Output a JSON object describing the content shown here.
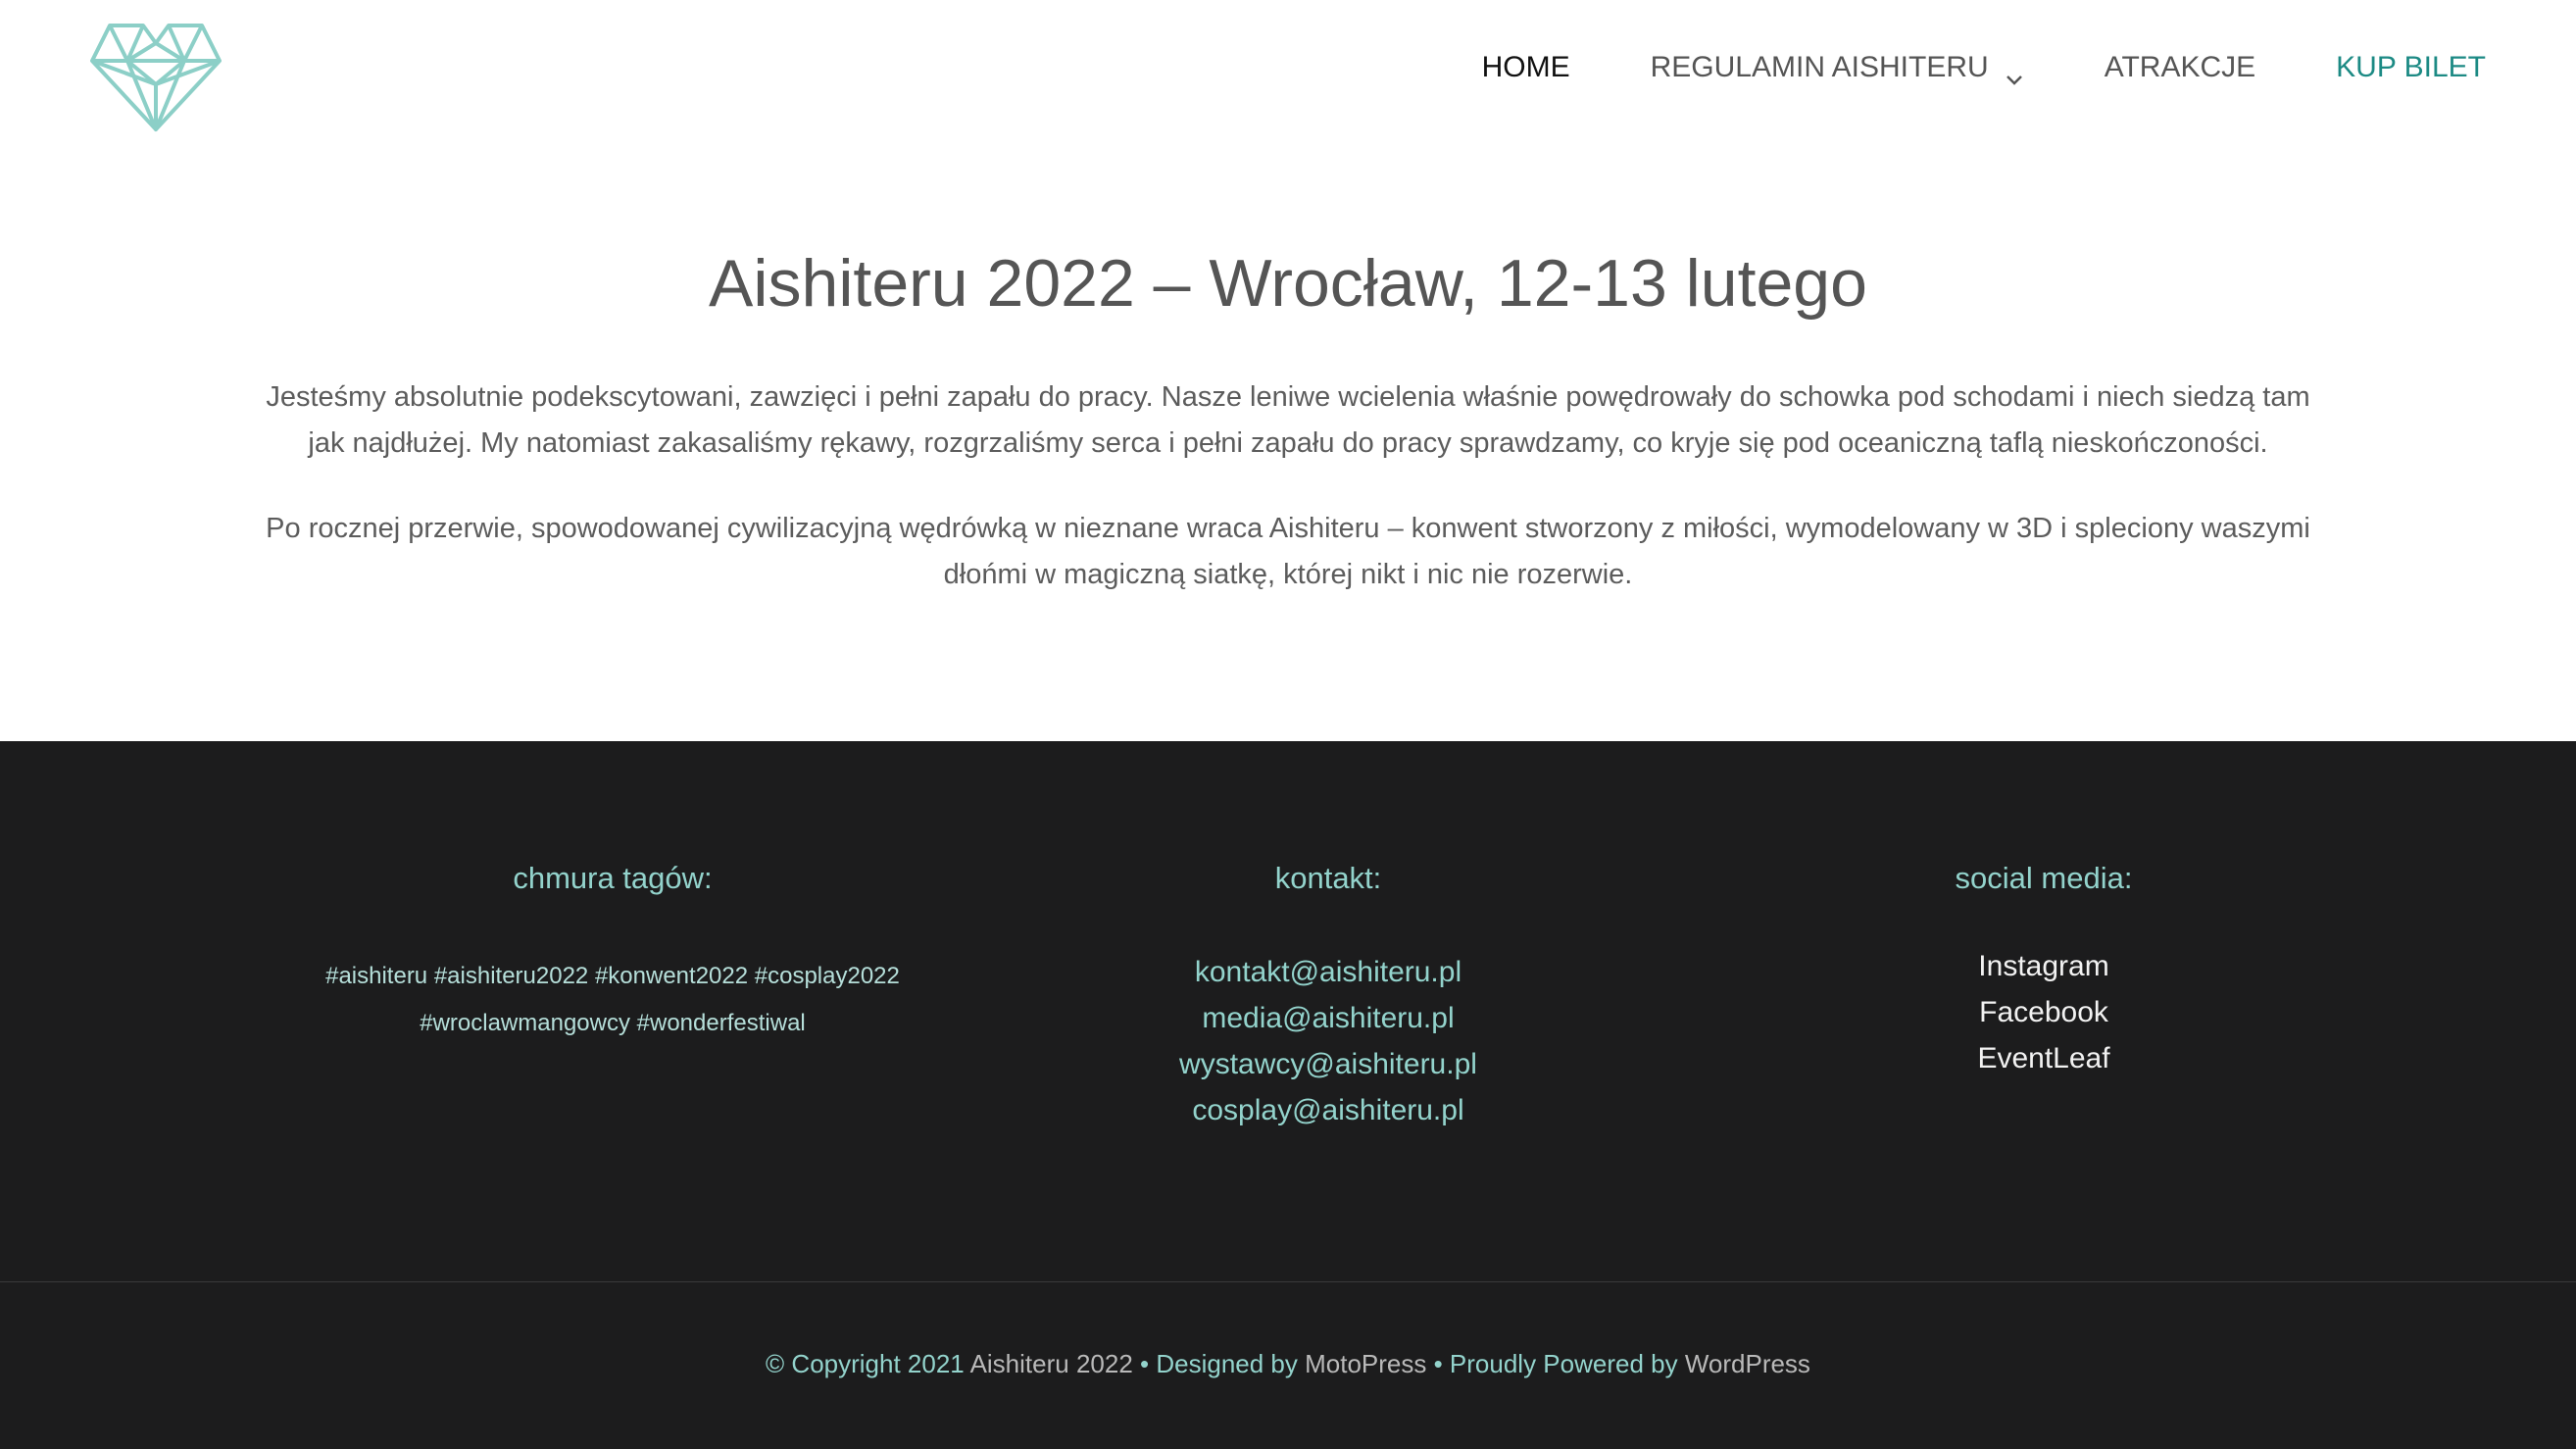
{
  "header": {
    "logo_name": "heart-logo",
    "nav": [
      {
        "label": "HOME",
        "state": "active"
      },
      {
        "label": "REGULAMIN AISHITERU",
        "has_dropdown": true
      },
      {
        "label": "ATRAKCJE"
      },
      {
        "label": "KUP BILET",
        "state": "highlight"
      }
    ]
  },
  "main": {
    "title": "Aishiteru 2022 – Wrocław, 12-13 lutego",
    "paragraphs": [
      "Jesteśmy absolutnie podekscytowani, zawzięci i pełni zapału do pracy. Nasze leniwe wcielenia właśnie powędrowały do schowka pod schodami i niech siedzą tam jak najdłużej. My natomiast zakasaliśmy rękawy, rozgrzaliśmy serca i pełni zapału do pracy sprawdzamy, co kryje się pod oceaniczną taflą nieskończoności.",
      "Po rocznej przerwie, spowodowanej cywilizacyjną wędrówką w nieznane wraca Aishiteru – konwent stworzony z miłości, wymodelowany w 3D i spleciony waszymi dłońmi w magiczną siatkę, której nikt i nic nie rozerwie."
    ]
  },
  "footer": {
    "tags": {
      "heading": "chmura tagów:",
      "line1": [
        "#aishiteru",
        "#aishiteru2022",
        "#konwent2022",
        "#cosplay2022"
      ],
      "line2": [
        "#wroclawmangowcy",
        "#wonderfestiwal"
      ]
    },
    "contact": {
      "heading": "kontakt:",
      "emails": [
        "kontakt@aishiteru.pl",
        "media@aishiteru.pl",
        "wystawcy@aishiteru.pl",
        "cosplay@aishiteru.pl"
      ]
    },
    "social": {
      "heading": "social media:",
      "links": [
        "Instagram",
        "Facebook",
        "EventLeaf"
      ]
    },
    "copyright": {
      "prefix": "© Copyright 2021 ",
      "site": "Aishiteru 2022",
      "designed_label": " • Designed by ",
      "designer": "MotoPress",
      "powered_label": " • Proudly Powered by ",
      "platform": "WordPress"
    }
  },
  "colors": {
    "accent": "#1c8a84",
    "footer_bg": "#1c1c1d",
    "footer_accent": "#93d3cc",
    "logo": "#8ccfc7"
  }
}
